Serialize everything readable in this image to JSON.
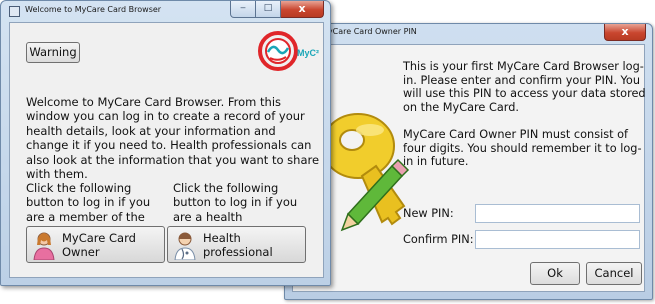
{
  "pin_window": {
    "title": "MyCare Card Owner PIN",
    "close_glyph": "x",
    "intro_text": "This is your first MyCare Card Browser log-in. Please enter and confirm your PIN. You will use this PIN to access your data stored on the MyCare Card.",
    "rule_text": "MyCare Card Owner PIN must consist of four digits. You should remember it to log-in in future.",
    "new_pin_label": "New PIN:",
    "new_pin_value": "",
    "confirm_pin_label": "Confirm PIN:",
    "confirm_pin_value": "",
    "ok_label": "Ok",
    "cancel_label": "Cancel",
    "icon": "key-icon"
  },
  "welcome_window": {
    "title": "Welcome to MyCare Card Browser",
    "minimize_glyph": "‒",
    "maximize_glyph": "□",
    "close_glyph": "x",
    "warning_label": "Warning",
    "logo_text": "MyC²",
    "intro_text": "Welcome to MyCare Card Browser. From this window you can log in to create a record of your health details, look at your information and change it if you need to. Health professionals can also look at the information that you want to share with them.",
    "public_text": "Click the following button to log in if you are a member of the public:",
    "professional_text": "Click the following button to log in if you are a health professional:",
    "owner_button_label": "MyCare Card Owner",
    "professional_button_label": "Health professional"
  },
  "colors": {
    "title_bar": "#c7d9ee",
    "close_button": "#c9462f",
    "logo_red": "#e0262a",
    "logo_teal": "#1aa6b7",
    "key_gold": "#e9c020",
    "pencil_green": "#5fb83a"
  }
}
